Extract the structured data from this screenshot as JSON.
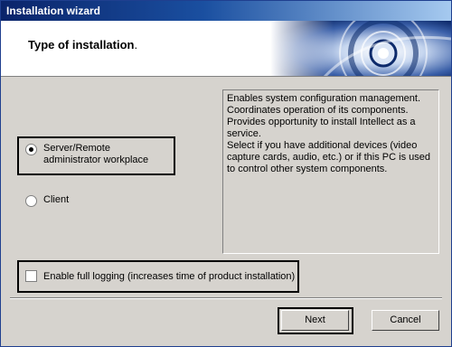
{
  "window": {
    "title": "Installation wizard"
  },
  "header": {
    "title": "Type of installation",
    "title_suffix": "."
  },
  "description": {
    "lines": [
      "Enables system configuration management.",
      "Coordinates operation of its components.",
      "Provides opportunity to install Intellect as a service.",
      "Select if you have additional devices (video capture cards, audio, etc.) or if this PC is used to control other system components."
    ]
  },
  "options": {
    "server": {
      "label": "Server/Remote administrator workplace",
      "checked": true
    },
    "client": {
      "label": "Client",
      "checked": false
    }
  },
  "logging": {
    "label": "Enable full logging (increases time of product installation)",
    "checked": false
  },
  "buttons": {
    "next": "Next",
    "cancel": "Cancel"
  }
}
